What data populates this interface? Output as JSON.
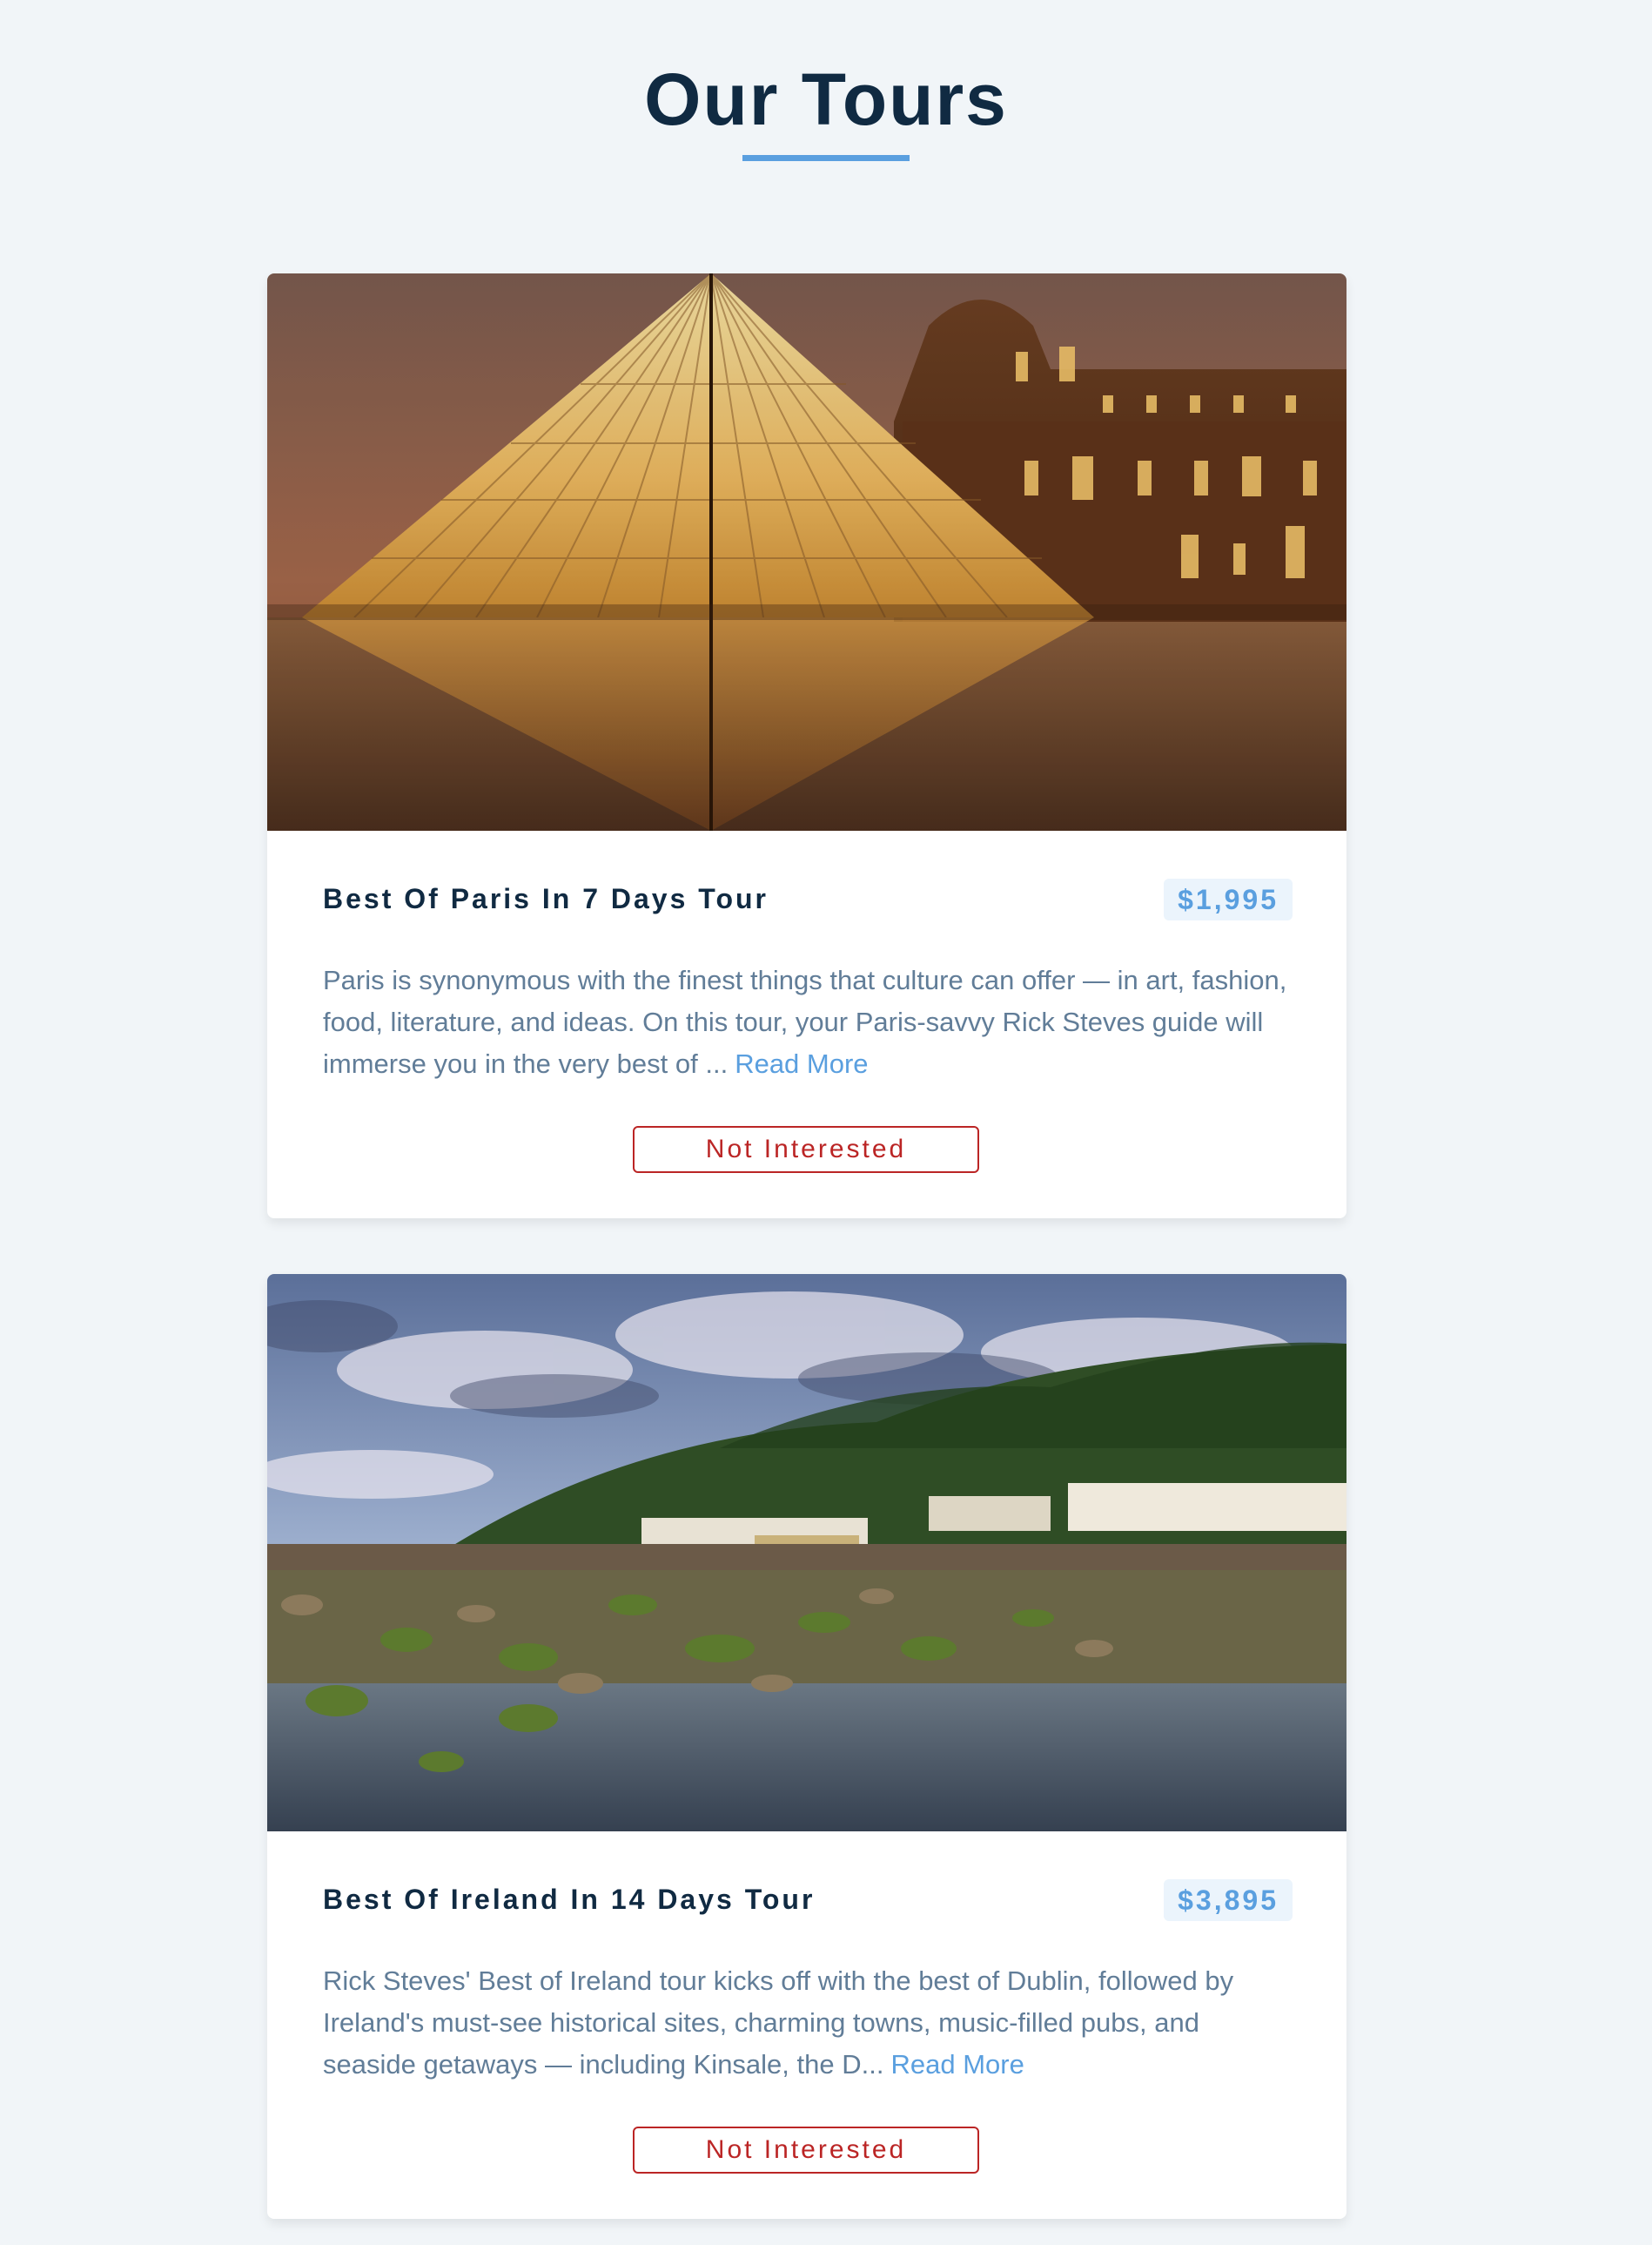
{
  "page": {
    "title": "Our Tours"
  },
  "tours": [
    {
      "name": "Best Of Paris In 7 Days Tour",
      "price": "$1,995",
      "description": "Paris is synonymous with the finest things that culture can offer — in art, fashion, food, literature, and ideas. On this tour, your Paris-savvy Rick Steves guide will immerse you in the very best of ...",
      "read_more_label": "Read More",
      "not_interested_label": "Not Interested",
      "image_subject": "louvre-pyramid-at-night"
    },
    {
      "name": "Best Of Ireland In 14 Days Tour",
      "price": "$3,895",
      "description": "Rick Steves' Best of Ireland tour kicks off with the best of Dublin, followed by Ireland's must-see historical sites, charming towns, music-filled pubs, and seaside getaways — including Kinsale, the D...",
      "read_more_label": "Read More",
      "not_interested_label": "Not Interested",
      "image_subject": "irish-coastal-village"
    }
  ],
  "colors": {
    "background": "#f1f5f8",
    "heading": "#102a42",
    "accent": "#5a9fdf",
    "text_muted": "#617d98",
    "danger": "#bb2525"
  }
}
